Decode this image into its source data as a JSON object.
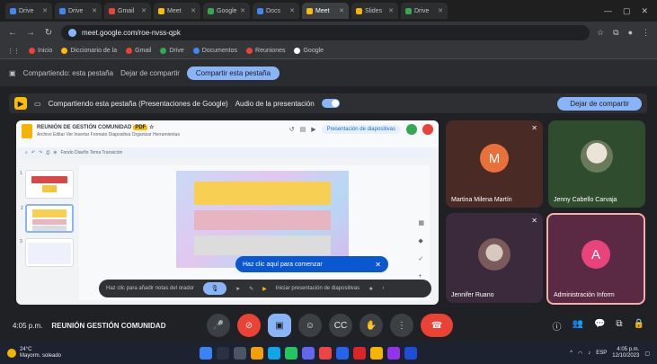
{
  "browser": {
    "tabs": [
      {
        "label": "Drive"
      },
      {
        "label": "Drive"
      },
      {
        "label": "Gmail"
      },
      {
        "label": "Meet"
      },
      {
        "label": "Google"
      },
      {
        "label": "Docs"
      },
      {
        "label": "Meet"
      },
      {
        "label": "Slides"
      },
      {
        "label": "Drive"
      }
    ],
    "url": "meet.google.com/roe-nvss-qpk",
    "bookmarks": [
      "Inicio",
      "Diccionario de la",
      "Gmail",
      "Drive",
      "Documentos",
      "Reuniones",
      "Google"
    ]
  },
  "sharebar": {
    "text": "Compartiendo: esta pestaña",
    "stop_text": "Dejar de compartir",
    "share_button": "Compartir esta pestaña"
  },
  "meet": {
    "presenting_text": "Compartiendo esta pestaña (Presentaciones de Google)",
    "audio_label": "Audio de la presentación",
    "stop_button": "Dejar de compartir"
  },
  "slides": {
    "doc_title": "REUNIÓN DE GESTIÓN COMUNIDAD",
    "doc_badge": "PDF",
    "menu": "Archivo  Editar  Ver  Insertar  Formato  Diapositiva  Organizar  Herramientas",
    "toolbar_text": "Fondo   Diseño   Tema   Transición",
    "slideshow_label": "Presentación de diapositivas",
    "thumb_numbers": [
      "1",
      "2",
      "3"
    ],
    "tooltip": "Haz clic aquí para comenzar",
    "notes_placeholder": "Haz clic para añadir notas del orador",
    "notes_action": "Iniciar presentación de diapositivas"
  },
  "participants": [
    {
      "name": "Martina Milena Martín",
      "initial": "M",
      "avatar_color": "#e8713b"
    },
    {
      "name": "Jenny Cabello Carvaja",
      "initial": "",
      "avatar_color": ""
    },
    {
      "name": "Jennifer Ruano",
      "initial": "",
      "avatar_color": ""
    },
    {
      "name": "Administración Inform",
      "initial": "A",
      "avatar_color": "#e8437a"
    }
  ],
  "controls": {
    "time": "4:05 p.m.",
    "meeting_name": "REUNIÓN GESTIÓN COMUNIDAD",
    "icons": [
      "mic-icon",
      "camera-icon",
      "present-icon",
      "emoji-icon",
      "captions-icon",
      "raise-hand-icon",
      "more-icon",
      "hangup-icon"
    ]
  },
  "taskbar": {
    "temp": "24°C",
    "weather": "Mayorm. soleado",
    "lang": "ESP",
    "time": "4:05 p.m.",
    "date": "12/10/2023"
  }
}
